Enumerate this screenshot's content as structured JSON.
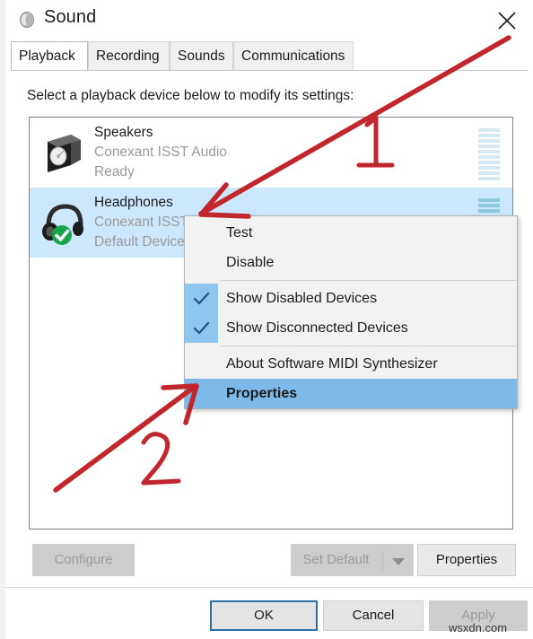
{
  "window": {
    "title": "Sound",
    "title_icon": "speaker-icon",
    "close_label": "✕"
  },
  "tabs": [
    {
      "label": "Playback",
      "active": true
    },
    {
      "label": "Recording",
      "active": false
    },
    {
      "label": "Sounds",
      "active": false
    },
    {
      "label": "Communications",
      "active": false
    }
  ],
  "instruction": "Select a playback device below to modify its settings:",
  "devices": [
    {
      "name": "Speakers",
      "description": "Conexant ISST Audio",
      "status": "Ready",
      "icon": "speaker-box-icon",
      "selected": false,
      "default_badge": false,
      "meter_segments": 10,
      "meter_active": 0
    },
    {
      "name": "Headphones",
      "description": "Conexant ISST",
      "status": "Default Device",
      "icon": "headphones-icon",
      "selected": true,
      "default_badge": true,
      "meter_segments": 3,
      "meter_active": 3
    }
  ],
  "context_menu": {
    "items": [
      {
        "label": "Test",
        "checked": false,
        "highlight": false,
        "separator_after": true
      },
      {
        "label": "Disable",
        "checked": false,
        "highlight": false,
        "separator_after": true
      },
      {
        "label": "Show Disabled Devices",
        "checked": true,
        "highlight": false,
        "separator_after": false
      },
      {
        "label": "Show Disconnected Devices",
        "checked": true,
        "highlight": false,
        "separator_after": true
      },
      {
        "label": "About Software MIDI Synthesizer",
        "checked": false,
        "highlight": false,
        "separator_after": false
      },
      {
        "label": "Properties",
        "checked": false,
        "highlight": true,
        "separator_after": false
      }
    ]
  },
  "buttons": {
    "configure": {
      "label": "Configure",
      "disabled": true
    },
    "set_default": {
      "label": "Set Default",
      "disabled": true
    },
    "set_default_arrow": {
      "label": "chevron-down-icon",
      "disabled": true
    },
    "properties": {
      "label": "Properties",
      "disabled": false
    },
    "ok": {
      "label": "OK",
      "disabled": false,
      "focused": true
    },
    "cancel": {
      "label": "Cancel",
      "disabled": false
    },
    "apply": {
      "label": "Apply",
      "disabled": true
    }
  },
  "annotations": {
    "marker_one": "1",
    "marker_two": "2",
    "color": "#c0262b"
  },
  "watermark": "wsxdn.com",
  "colors": {
    "selection": "#cce8ff",
    "menu_highlight": "#7cb8e8",
    "check_bg": "#8ec6ef",
    "focus_border": "#2f6da5",
    "annotation_red": "#c0262b",
    "default_badge_green": "#16a34a"
  }
}
